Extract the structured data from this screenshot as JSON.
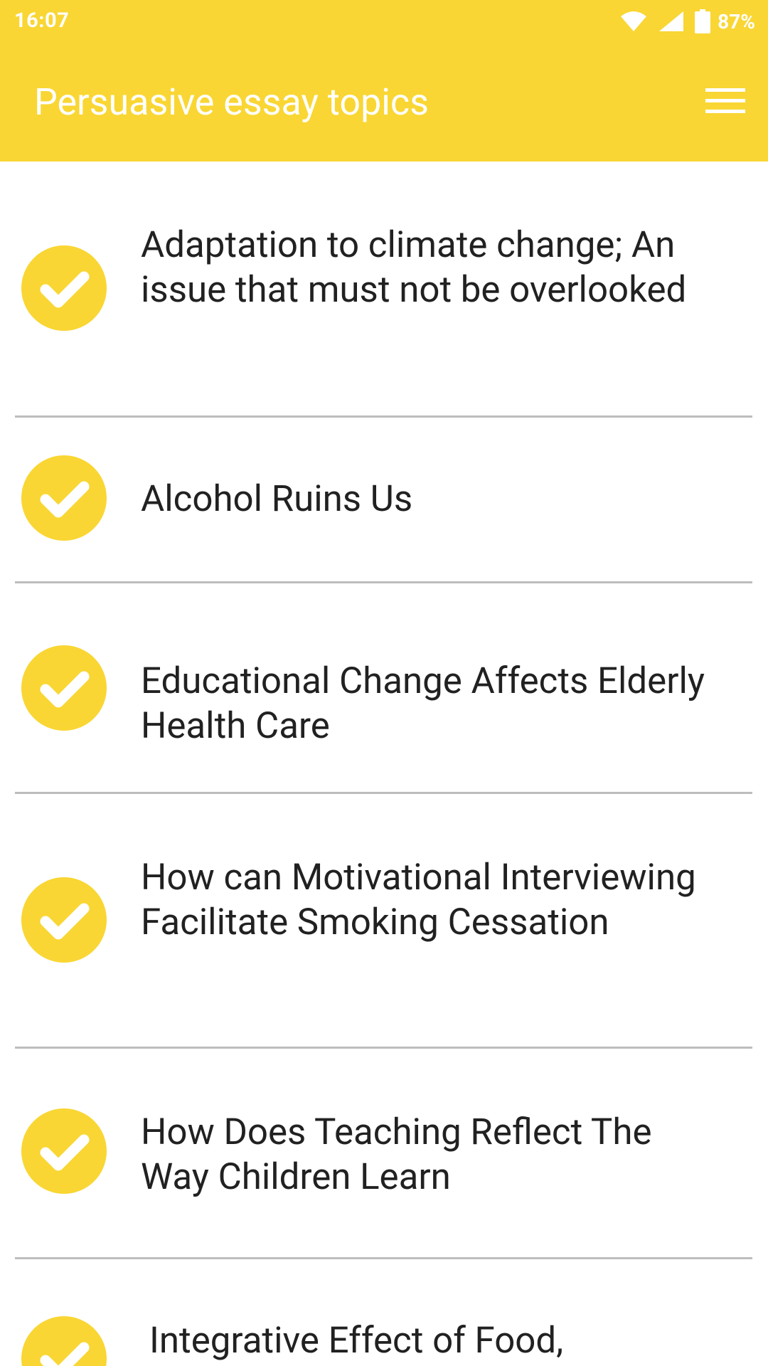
{
  "status_bar": {
    "time": "16:07",
    "battery": "87%",
    "icons": [
      "wifi-icon",
      "cellular-signal-icon",
      "battery-icon"
    ]
  },
  "app_bar": {
    "title": "Persuasive essay topics",
    "menu_icon": "hamburger-menu-icon"
  },
  "colors": {
    "accent": "#F9D633",
    "text": "#212121",
    "divider": "#BDBDBD",
    "background": "#FFFFFF"
  },
  "topics": [
    {
      "label": "Adaptation to climate change; An issue that must not be overlooked",
      "icon": "check-circle-icon"
    },
    {
      "label": "Alcohol Ruins Us",
      "icon": "check-circle-icon"
    },
    {
      "label": "Educational Change Affects Elderly Health Care",
      "icon": "check-circle-icon"
    },
    {
      "label": "How can Motivational Interviewing Facilitate Smoking Cessation",
      "icon": "check-circle-icon"
    },
    {
      "label": "How Does Teaching Reflect The Way Children Learn",
      "icon": "check-circle-icon"
    },
    {
      "label": "Integrative Effect of Food,",
      "icon": "check-circle-icon"
    }
  ]
}
